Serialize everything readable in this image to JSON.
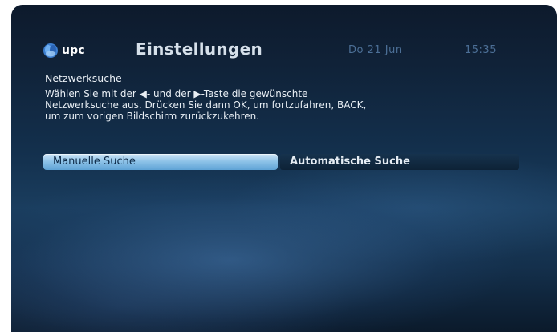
{
  "header": {
    "logo_text": "upc",
    "title": "Einstellungen",
    "date": "Do 21 Jun",
    "time": "15:35"
  },
  "content": {
    "heading": "Netzwerksuche",
    "instruction_lines": [
      "Wählen Sie mit der ◀- und der ▶-Taste die gewünschte",
      "Netzwerksuche aus. Drücken Sie dann OK, um fortzufahren, BACK,",
      "um zum vorigen Bildschirm zurückzukehren."
    ]
  },
  "options": [
    {
      "label": "Manuelle Suche",
      "selected": true
    },
    {
      "label": "Automatische Suche",
      "selected": false
    }
  ],
  "icons": {
    "logo": "upc-logo-icon"
  },
  "colors": {
    "selected_option": "#8fc3e8",
    "background": "#13304d",
    "date_time": "#4c6f96"
  }
}
